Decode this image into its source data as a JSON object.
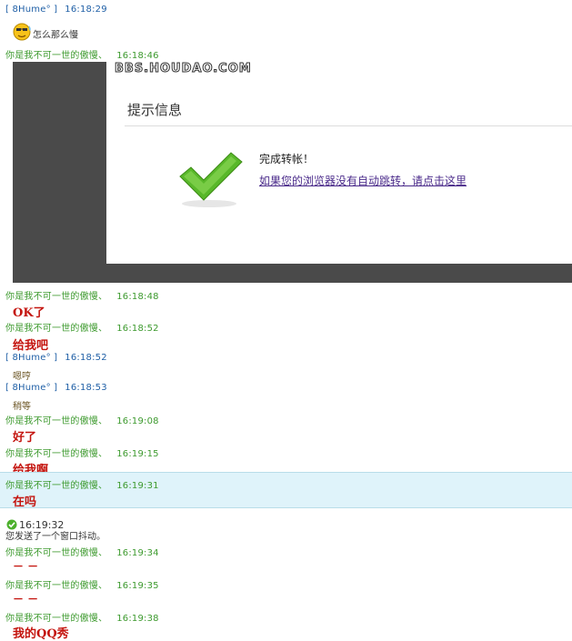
{
  "messages": [
    {
      "sender": "[ 8Hume° ]",
      "time": "16:18:29"
    },
    {
      "text": "怎么那么慢"
    },
    {
      "sender": "你是我不可一世的傲慢、",
      "time": "16:18:46"
    },
    {
      "sender": "你是我不可一世的傲慢、",
      "time": "16:18:48"
    },
    {
      "text": "OK了"
    },
    {
      "sender": "你是我不可一世的傲慢、",
      "time": "16:18:52"
    },
    {
      "text": "给我吧"
    },
    {
      "sender": "[ 8Hume° ]",
      "time": "16:18:52"
    },
    {
      "text": "嗯哼"
    },
    {
      "sender": "[ 8Hume° ]",
      "time": "16:18:53"
    },
    {
      "text": "稍等"
    },
    {
      "sender": "你是我不可一世的傲慢、",
      "time": "16:19:08"
    },
    {
      "text": "好了"
    },
    {
      "sender": "你是我不可一世的傲慢、",
      "time": "16:19:15"
    },
    {
      "text": "给我啊"
    },
    {
      "sender": "你是我不可一世的傲慢、",
      "time": "16:19:31"
    },
    {
      "text": "在吗"
    },
    {
      "time": "16:19:32",
      "text": "您发送了一个窗口抖动。"
    },
    {
      "sender": "你是我不可一世的傲慢、",
      "time": "16:19:34"
    },
    {
      "text": "－ －"
    },
    {
      "sender": "你是我不可一世的傲慢、",
      "time": "16:19:35"
    },
    {
      "text": "－ －"
    },
    {
      "sender": "你是我不可一世的傲慢、",
      "time": "16:19:38"
    },
    {
      "text": "我的QQ秀"
    }
  ],
  "screenshot": {
    "logo": "BBS.HOUDAO.COM",
    "title": "提示信息",
    "message": "完成转帐！",
    "link": "如果您的浏览器没有自动跳转，请点击这里"
  }
}
